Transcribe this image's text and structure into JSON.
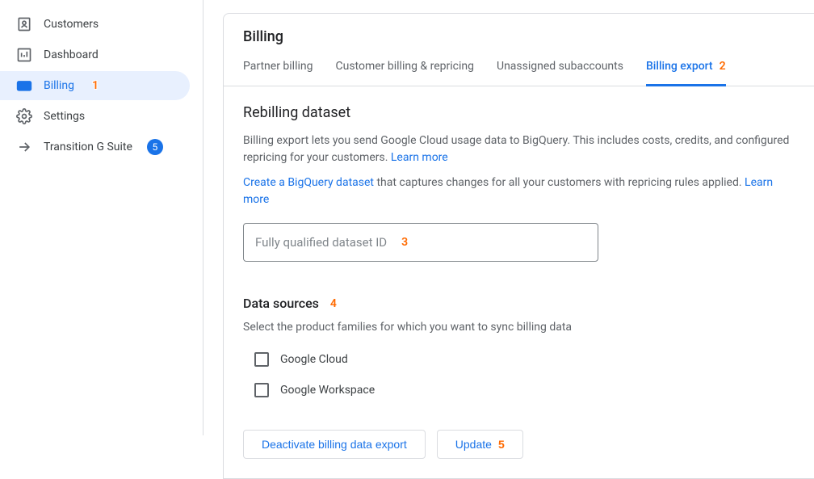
{
  "sidebar": {
    "items": [
      {
        "label": "Customers"
      },
      {
        "label": "Dashboard"
      },
      {
        "label": "Billing",
        "active": true,
        "annotation": "1"
      },
      {
        "label": "Settings"
      },
      {
        "label": "Transition G Suite",
        "badge": "5"
      }
    ]
  },
  "page": {
    "title": "Billing",
    "tabs": [
      {
        "label": "Partner billing"
      },
      {
        "label": "Customer billing & repricing"
      },
      {
        "label": "Unassigned subaccounts"
      },
      {
        "label": "Billing export",
        "active": true,
        "annotation": "2"
      }
    ]
  },
  "rebilling": {
    "heading": "Rebilling dataset",
    "desc_prefix": "Billing export lets you send Google Cloud usage data to BigQuery. This includes costs, credits, and configured repricing for your customers. ",
    "learn_more": "Learn more",
    "create_link": "Create a BigQuery dataset",
    "create_suffix": " that captures changes for all your customers with repricing rules applied. ",
    "input_placeholder": "Fully qualified dataset ID",
    "input_annotation": "3"
  },
  "data_sources": {
    "heading": "Data sources",
    "heading_annotation": "4",
    "desc": "Select the product families for which you want to sync billing data",
    "options": [
      {
        "label": "Google Cloud"
      },
      {
        "label": "Google Workspace"
      }
    ]
  },
  "actions": {
    "deactivate": "Deactivate billing data export",
    "update": "Update",
    "update_annotation": "5"
  }
}
